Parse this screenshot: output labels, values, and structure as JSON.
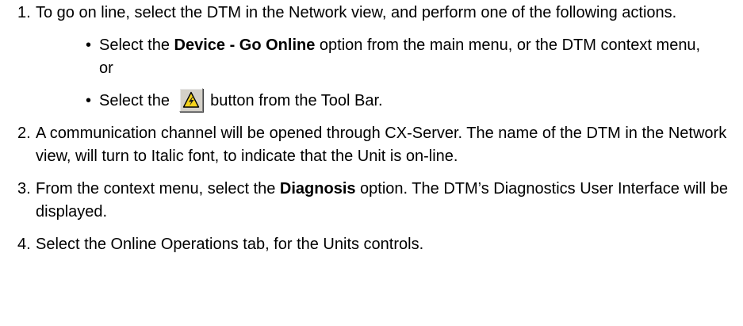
{
  "steps": [
    {
      "number": "1.",
      "text": "To go on line, select the DTM in the Network view, and perform one of the following actions.",
      "bullets": [
        {
          "symbol": "•",
          "prefix": "Select the ",
          "bold": "Device - Go Online",
          "suffix": " option from the main menu, or the DTM context menu, or"
        },
        {
          "symbol": "•",
          "prefix": "Select the ",
          "icon": "go-online-lightning-warning-icon",
          "suffix": " button from the Tool Bar."
        }
      ]
    },
    {
      "number": "2.",
      "text": "A communication channel will be opened through CX-Server. The name of the DTM in the Network view, will turn to Italic font, to indicate that the Unit is on-line."
    },
    {
      "number": "3.",
      "prefix": "From the context menu, select the ",
      "bold": "Diagnosis",
      "suffix": " option. The DTM’s Diagnostics User Interface will be displayed."
    },
    {
      "number": "4.",
      "text": "Select the Online Operations tab, for the Units controls."
    }
  ],
  "colors": {
    "icon_yellow": "#f4d21c",
    "icon_outline": "#000000",
    "button_face": "#d4d0c8"
  }
}
